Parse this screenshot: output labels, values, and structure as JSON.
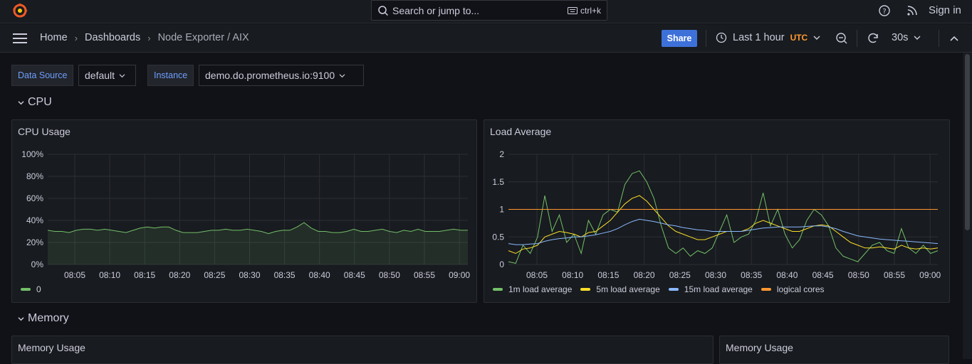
{
  "topbar": {
    "search_placeholder": "Search or jump to...",
    "shortcut": "ctrl+k",
    "sign_in": "Sign in"
  },
  "nav": {
    "breadcrumbs": [
      "Home",
      "Dashboards",
      "Node Exporter / AIX"
    ],
    "share": "Share",
    "time_range": "Last 1 hour",
    "timezone": "UTC",
    "refresh_interval": "30s"
  },
  "variables": [
    {
      "label": "Data Source",
      "value": "default"
    },
    {
      "label": "Instance",
      "value": "demo.do.prometheus.io:9100"
    }
  ],
  "rows": {
    "cpu": "CPU",
    "memory": "Memory"
  },
  "panels": {
    "cpu_usage": "CPU Usage",
    "load_average": "Load Average",
    "memory_usage_1": "Memory Usage",
    "memory_usage_2": "Memory Usage"
  },
  "colors": {
    "green": "#73bf69",
    "yellow": "#fade2a",
    "blue": "#8ab8ff",
    "orange": "#ff9830",
    "accent": "#3d71d9"
  },
  "chart_data": [
    {
      "type": "area",
      "title": "CPU Usage",
      "x": [
        "08:05",
        "08:10",
        "08:15",
        "08:20",
        "08:25",
        "08:30",
        "08:35",
        "08:40",
        "08:45",
        "08:50",
        "08:55",
        "09:00"
      ],
      "yticks": [
        "100%",
        "80%",
        "60%",
        "40%",
        "20%",
        "0%"
      ],
      "ylim": [
        0,
        100
      ],
      "series": [
        {
          "name": "0",
          "color": "#73bf69",
          "values": [
            31,
            30,
            30,
            29,
            31,
            32,
            32,
            31,
            32,
            31,
            30,
            29,
            31,
            33,
            34,
            33,
            34,
            34,
            31,
            29,
            29,
            29,
            30,
            31,
            31,
            32,
            31,
            31,
            32,
            31,
            30,
            28,
            30,
            31,
            31,
            34,
            38,
            33,
            30,
            30,
            29,
            29,
            30,
            32,
            30,
            30,
            31,
            32,
            30,
            29,
            31,
            30,
            32,
            30,
            30,
            30,
            31,
            32,
            31,
            31
          ]
        }
      ],
      "legend": "bottom-left"
    },
    {
      "type": "line",
      "title": "Load Average",
      "x": [
        "08:05",
        "08:10",
        "08:15",
        "08:20",
        "08:25",
        "08:30",
        "08:35",
        "08:40",
        "08:45",
        "08:50",
        "08:55",
        "09:00"
      ],
      "yticks": [
        "2",
        "1.5",
        "1",
        "0.5",
        "0"
      ],
      "ylim": [
        0,
        2
      ],
      "series": [
        {
          "name": "1m load average",
          "color": "#73bf69",
          "values": [
            0.05,
            0.02,
            0.35,
            0.2,
            0.5,
            1.25,
            0.6,
            0.9,
            0.4,
            0.55,
            0.2,
            0.8,
            0.55,
            0.9,
            1.0,
            0.95,
            1.45,
            1.65,
            1.7,
            1.5,
            1.2,
            0.7,
            0.3,
            0.2,
            0.3,
            0.15,
            0.25,
            0.2,
            0.3,
            0.6,
            0.9,
            0.4,
            0.5,
            0.55,
            0.8,
            1.3,
            0.7,
            1.0,
            0.55,
            0.3,
            0.45,
            0.8,
            1.0,
            0.9,
            0.7,
            0.3,
            0.15,
            0.1,
            0.05,
            0.2,
            0.35,
            0.4,
            0.25,
            0.2,
            0.65,
            0.3,
            0.2,
            0.35,
            0.2,
            0.25
          ]
        },
        {
          "name": "5m load average",
          "color": "#fade2a",
          "values": [
            0.25,
            0.2,
            0.28,
            0.3,
            0.35,
            0.5,
            0.55,
            0.6,
            0.58,
            0.55,
            0.5,
            0.58,
            0.6,
            0.7,
            0.8,
            0.95,
            1.1,
            1.2,
            1.25,
            1.15,
            1.0,
            0.85,
            0.7,
            0.6,
            0.55,
            0.5,
            0.45,
            0.45,
            0.5,
            0.55,
            0.6,
            0.6,
            0.6,
            0.65,
            0.75,
            0.8,
            0.75,
            0.7,
            0.65,
            0.6,
            0.6,
            0.65,
            0.7,
            0.72,
            0.7,
            0.6,
            0.5,
            0.4,
            0.35,
            0.3,
            0.3,
            0.32,
            0.3,
            0.28,
            0.35,
            0.3,
            0.28,
            0.3,
            0.28,
            0.3
          ]
        },
        {
          "name": "15m load average",
          "color": "#8ab8ff",
          "values": [
            0.38,
            0.36,
            0.36,
            0.37,
            0.38,
            0.42,
            0.45,
            0.47,
            0.48,
            0.5,
            0.5,
            0.52,
            0.54,
            0.57,
            0.6,
            0.65,
            0.72,
            0.78,
            0.82,
            0.8,
            0.78,
            0.75,
            0.72,
            0.7,
            0.67,
            0.65,
            0.63,
            0.62,
            0.6,
            0.6,
            0.6,
            0.6,
            0.6,
            0.62,
            0.64,
            0.66,
            0.67,
            0.68,
            0.68,
            0.68,
            0.68,
            0.69,
            0.7,
            0.7,
            0.68,
            0.65,
            0.6,
            0.56,
            0.52,
            0.5,
            0.48,
            0.46,
            0.45,
            0.44,
            0.43,
            0.42,
            0.41,
            0.4,
            0.39,
            0.38
          ]
        },
        {
          "name": "logical cores",
          "color": "#ff9830",
          "values": [
            1,
            1,
            1,
            1,
            1,
            1,
            1,
            1,
            1,
            1,
            1,
            1,
            1,
            1,
            1,
            1,
            1,
            1,
            1,
            1,
            1,
            1,
            1,
            1,
            1,
            1,
            1,
            1,
            1,
            1,
            1,
            1,
            1,
            1,
            1,
            1,
            1,
            1,
            1,
            1,
            1,
            1,
            1,
            1,
            1,
            1,
            1,
            1,
            1,
            1,
            1,
            1,
            1,
            1,
            1,
            1,
            1,
            1,
            1,
            1
          ]
        }
      ],
      "legend": "bottom-left"
    }
  ]
}
